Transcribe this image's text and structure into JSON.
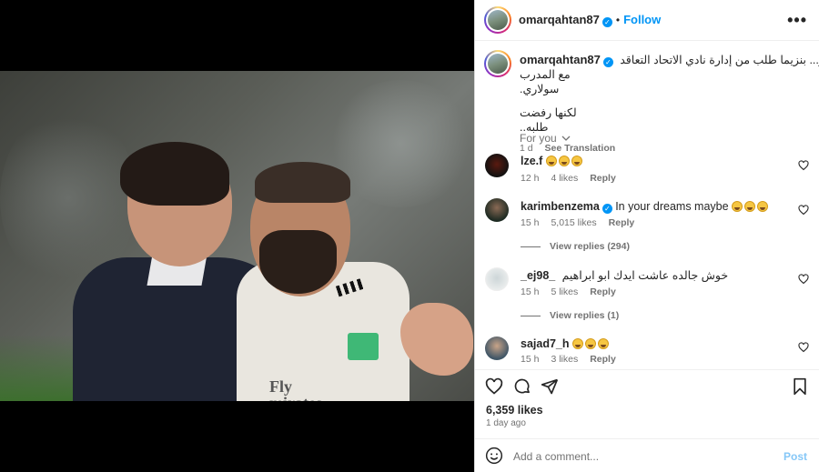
{
  "post": {
    "username": "omarqahtan87",
    "follow_label": "Follow",
    "separator": "•",
    "more_label": "•••",
    "caption_line1": "مصادر... بنزيما طلب من إدارة نادي الاتحاد التعاقد",
    "caption_line2": "مع المدرب سولاري.",
    "caption_line3": "لكنها رفضت طلبه..",
    "caption_age": "1 d",
    "see_translation": "See Translation",
    "for_you": "For you",
    "likes": "6,359 likes",
    "posted_ago": "1 day ago",
    "photo_text": "Fly\nmirates"
  },
  "comments": [
    {
      "user": "lze.f",
      "text": "",
      "emojis": 3,
      "age": "12 h",
      "likes": "4 likes",
      "reply": "Reply",
      "verified": false
    },
    {
      "user": "karimbenzema",
      "text": "In your dreams maybe",
      "emojis": 3,
      "age": "15 h",
      "likes": "5,015 likes",
      "reply": "Reply",
      "verified": true,
      "view_replies": "View replies (294)"
    },
    {
      "user": "_ej98_",
      "text": "خوش جالده عاشت ايدك ابو ابراهيم",
      "emojis": 0,
      "age": "15 h",
      "likes": "5 likes",
      "reply": "Reply",
      "verified": false,
      "view_replies": "View replies (1)"
    },
    {
      "user": "sajad7_h",
      "text": "",
      "emojis": 3,
      "age": "15 h",
      "likes": "3 likes",
      "reply": "Reply",
      "verified": false
    }
  ],
  "composer": {
    "placeholder": "Add a comment...",
    "post_label": "Post"
  },
  "icons": [
    "heart-icon",
    "comment-icon",
    "share-icon",
    "bookmark-icon",
    "emoji-icon",
    "verified-icon",
    "more-options-icon",
    "chevron-down-icon"
  ],
  "colors": {
    "accent": "#0095f6",
    "muted": "#737373",
    "post_disabled": "#85c7f7"
  }
}
